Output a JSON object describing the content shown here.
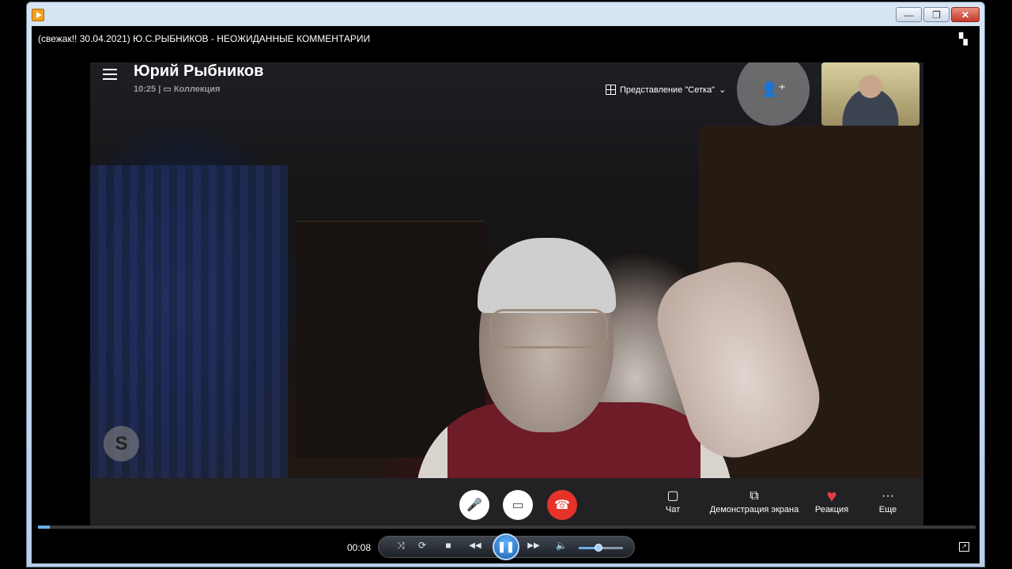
{
  "window": {
    "title": "(свежак!! 30.04.2021) Ю.С.РЫБНИКОВ - НЕОЖИДАННЫЕ КОММЕНТАРИИ",
    "buttons": {
      "minimize": "—",
      "maximize": "❐",
      "close": "✕"
    }
  },
  "call": {
    "caller_name": "Юрий Рыбников",
    "duration": "10:25",
    "separator": "|",
    "collection_label": "Коллекция",
    "view_mode_label": "Представление \"Сетка\"",
    "view_mode_chevron": "⌄",
    "add_person_icon": "👤⁺",
    "skype_logo_letter": "S",
    "controls": {
      "mic_icon": "🎤",
      "camera_icon": "▭",
      "hangup_icon": "☎"
    },
    "actions": [
      {
        "name": "chat",
        "icon": "▢",
        "label": "Чат"
      },
      {
        "name": "screen-share",
        "icon": "⧉",
        "label": "Демонстрация экрана"
      },
      {
        "name": "reaction",
        "icon": "♥",
        "label": "Реакция"
      },
      {
        "name": "more",
        "icon": "···",
        "label": "Еще"
      }
    ]
  },
  "player": {
    "current_time": "00:08",
    "progress": 0.013,
    "volume": 0.45,
    "buttons": {
      "shuffle": "⤨",
      "repeat": "⟳",
      "stop": "■",
      "rewind": "◀◀",
      "pause": "❚❚",
      "forward": "▶▶",
      "volume": "🔈"
    },
    "fullscreen_icon": "↗"
  },
  "colors": {
    "accent": "#6ab0e8",
    "hangup": "#e5332a",
    "reaction": "#e53a48"
  }
}
